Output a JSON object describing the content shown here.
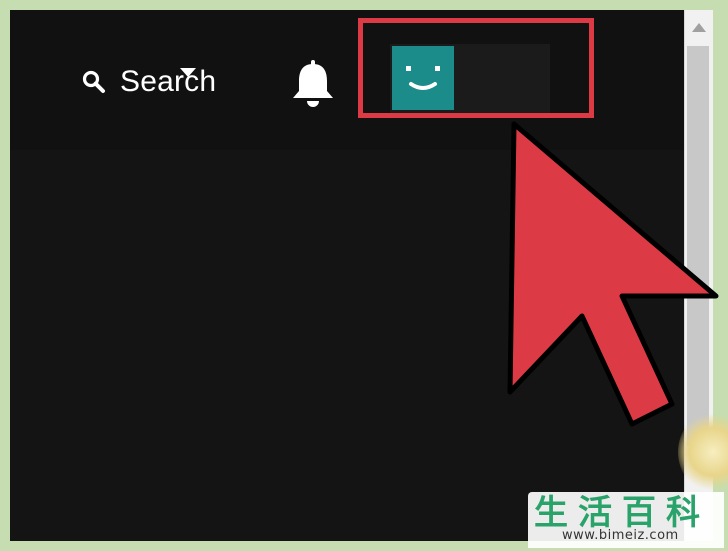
{
  "header": {
    "search_label": "Search",
    "search_icon": "search-icon",
    "notifications_icon": "bell-icon",
    "profile": {
      "avatar_icon": "smiley-avatar-icon",
      "avatar_color": "#1c8c8a",
      "menu_icon": "caret-down-icon"
    }
  },
  "annotation": {
    "highlight_color": "#dc3b46",
    "pointer_icon": "mouse-cursor-arrow"
  },
  "watermark": {
    "chars": [
      "生",
      "活",
      "百",
      "科"
    ],
    "url": "www.bimeiz.com",
    "color": "#2aa36a"
  }
}
